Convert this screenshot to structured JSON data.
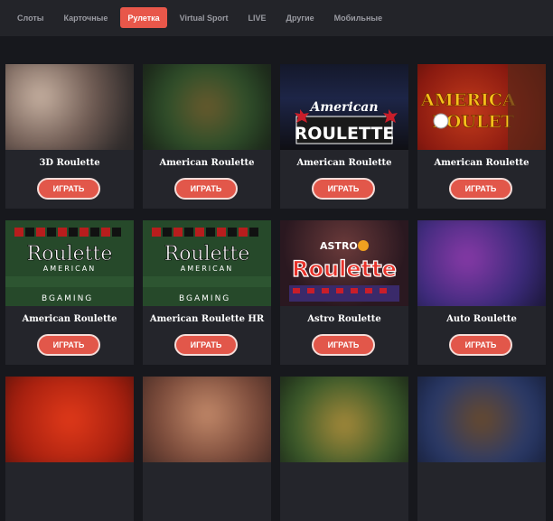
{
  "nav": {
    "tabs": [
      {
        "label": "Слоты"
      },
      {
        "label": "Карточные"
      },
      {
        "label": "Рулетка",
        "active": true
      },
      {
        "label": "Virtual Sport"
      },
      {
        "label": "LIVE"
      },
      {
        "label": "Другие"
      },
      {
        "label": "Мобильные"
      }
    ]
  },
  "games": [
    {
      "title": "3D Roulette",
      "button": "ИГРАТЬ"
    },
    {
      "title": "American Roulette",
      "button": "ИГРАТЬ"
    },
    {
      "title": "American Roulette",
      "button": "ИГРАТЬ",
      "logo": "American ROULETTE"
    },
    {
      "title": "American Roulette",
      "button": "ИГРАТЬ",
      "logo": "AMERICAN ROULETTE"
    },
    {
      "title": "American Roulette",
      "button": "ИГРАТЬ",
      "logo": "Roulette",
      "logo_sub": "AMERICAN",
      "provider": "BGAMING"
    },
    {
      "title": "American Roulette HR",
      "button": "ИГРАТЬ",
      "logo": "Roulette",
      "logo_sub": "AMERICAN",
      "provider": "BGAMING"
    },
    {
      "title": "Astro Roulette",
      "button": "ИГРАТЬ",
      "logo": "Roulette",
      "logo_sub": "ASTRO"
    },
    {
      "title": "Auto Roulette",
      "button": "ИГРАТЬ"
    },
    {
      "title": "",
      "button": ""
    },
    {
      "title": "",
      "button": ""
    },
    {
      "title": "",
      "button": ""
    },
    {
      "title": "",
      "button": ""
    }
  ],
  "colors": {
    "accent": "#e2574a",
    "bg": "#17181d",
    "card": "#24252b"
  }
}
